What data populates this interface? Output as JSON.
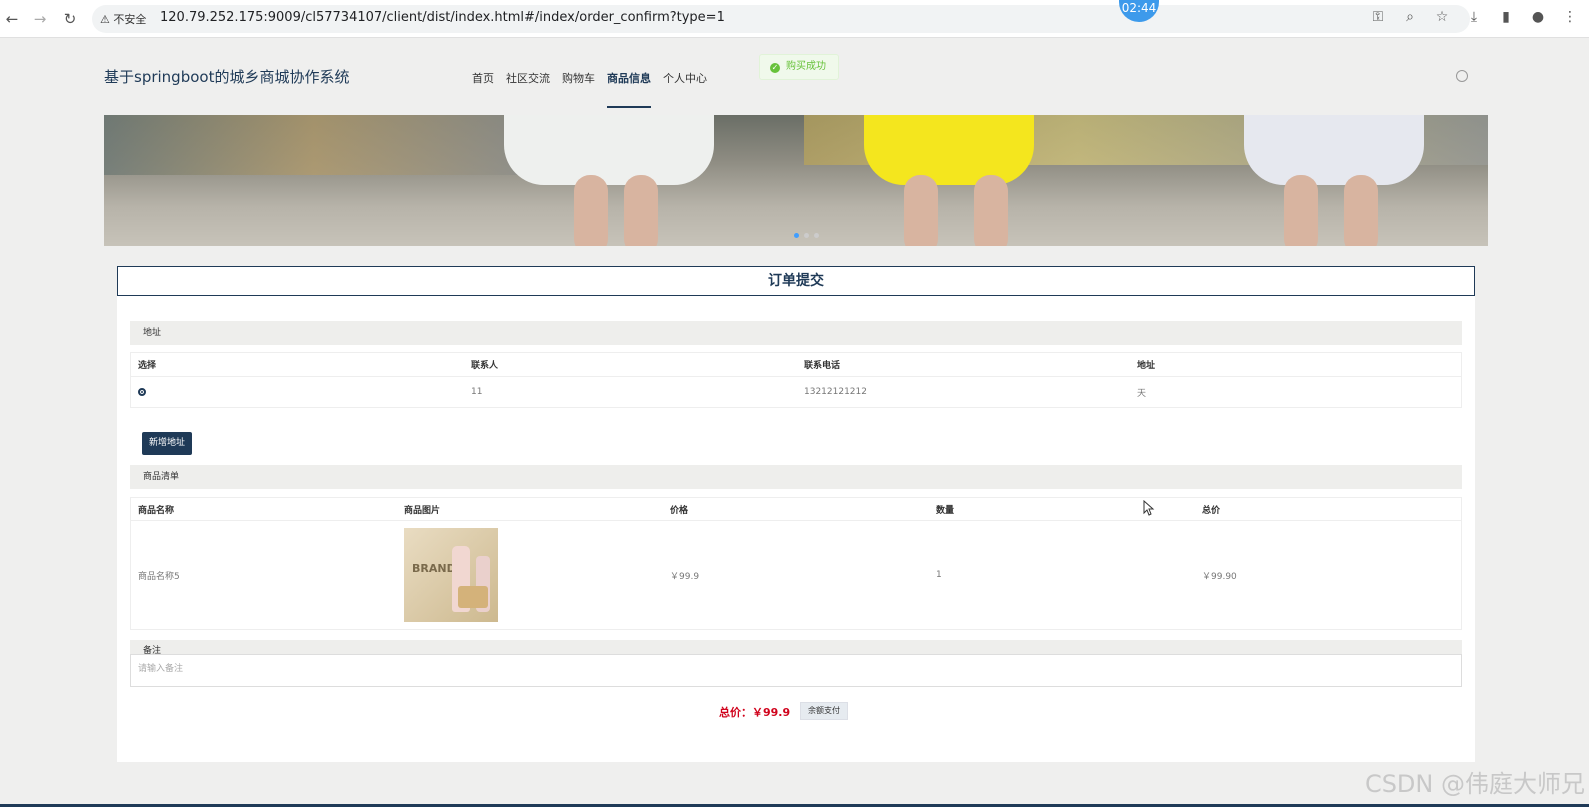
{
  "browser": {
    "insecure_label": "不安全",
    "url": "120.79.252.175:9009/cl57734107/client/dist/index.html#/index/order_confirm?type=1",
    "timer": "02:44"
  },
  "header": {
    "site_title": "基于springboot的城乡商城协作系统",
    "nav": [
      "首页",
      "社区交流",
      "购物车",
      "商品信息",
      "个人中心"
    ],
    "active_nav": "商品信息",
    "toast": "购买成功"
  },
  "order": {
    "title": "订单提交",
    "address_section": "地址",
    "address_columns": [
      "选择",
      "联系人",
      "联系电话",
      "地址"
    ],
    "address_rows": [
      {
        "contact": "11",
        "phone": "13212121212",
        "address": "天"
      }
    ],
    "add_address_button": "新增地址",
    "goods_section": "商品清单",
    "goods_columns": [
      "商品名称",
      "商品图片",
      "价格",
      "数量",
      "总价"
    ],
    "goods_rows": [
      {
        "name": "商品名称5",
        "image_label": "BRAND",
        "price": "￥99.9",
        "qty": "1",
        "total": "￥99.90"
      }
    ],
    "note_section": "备注",
    "note_placeholder": "请输入备注",
    "total_label": "总价：",
    "total_value": "￥99.9",
    "pay_button": "余额支付"
  },
  "watermark": "CSDN @伟庭大师兄",
  "colors": {
    "primary": "#1f3a57",
    "price": "#d0021b",
    "success": "#67c23a"
  }
}
